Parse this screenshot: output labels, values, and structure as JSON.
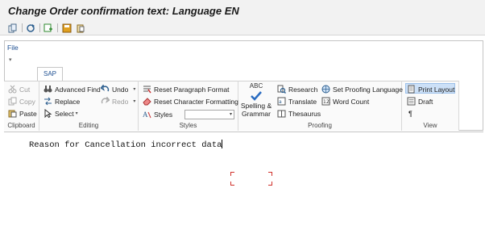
{
  "window": {
    "title": "Change Order confirmation text: Language EN"
  },
  "toolbar": {
    "icons": [
      "copy-icon",
      "refresh-icon",
      "insert-icon",
      "save-icon",
      "paste-icon"
    ]
  },
  "menu": {
    "file_label": "File"
  },
  "tabs": [
    {
      "label": "SAP"
    }
  ],
  "ribbon": {
    "clipboard": {
      "label": "Clipboard",
      "cut": "Cut",
      "copy": "Copy",
      "paste": "Paste"
    },
    "editing": {
      "label": "Editing",
      "advanced_find": "Advanced Find",
      "replace": "Replace",
      "select": "Select",
      "undo": "Undo",
      "redo": "Redo"
    },
    "styles": {
      "label": "Styles",
      "reset_paragraph": "Reset Paragraph Format",
      "reset_character": "Reset Character Formatting",
      "styles_button": "Styles",
      "styles_value": ""
    },
    "proofing": {
      "label": "Proofing",
      "spelling_abc": "ABC",
      "spelling_line1": "Spelling &",
      "spelling_line2": "Grammar",
      "research": "Research",
      "translate": "Translate",
      "thesaurus": "Thesaurus",
      "set_language": "Set Proofing Language",
      "word_count": "Word Count"
    },
    "view": {
      "label": "View",
      "print_layout": "Print Layout",
      "draft": "Draft",
      "pilcrow": "¶"
    }
  },
  "document": {
    "text": "Reason for Cancellation incorrect data"
  },
  "colors": {
    "accent": "#1d4f91",
    "selected": "#cce0f7",
    "crop_marks": "#d0302a"
  }
}
